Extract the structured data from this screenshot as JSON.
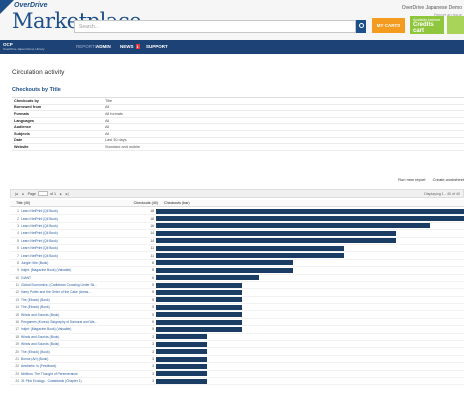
{
  "header": {
    "brand_small": "OverDrive",
    "brand_big": "Marketplace",
    "search_placeholder": "Search...",
    "user_line1": "OverDrive Japanese Demo",
    "user_line2": "Report an issue",
    "orange_button": "MY CARTS",
    "credits_caption": "Available balance",
    "credits_label": "Credits cart"
  },
  "nav": {
    "org_name": "OCP",
    "org_sub": "OverDrive Japan Demo Library",
    "items": [
      {
        "label": "REPORTS",
        "dim": true
      },
      {
        "label": "ADMIN",
        "dim": false
      },
      {
        "label": "NEWS",
        "dim": false,
        "badge": "1"
      },
      {
        "label": "SUPPORT",
        "dim": false
      }
    ]
  },
  "page": {
    "title": "Circulation activity",
    "section_title": "Checkouts by Title"
  },
  "criteria": [
    {
      "key": "Checkouts by",
      "value": "Title"
    },
    {
      "key": "Borrowed from",
      "value": "All"
    },
    {
      "key": "Formats",
      "value": "All formats"
    },
    {
      "key": "Languages",
      "value": "All"
    },
    {
      "key": "Audience",
      "value": "All"
    },
    {
      "key": "Subjects",
      "value": "All"
    },
    {
      "key": "Date",
      "value": "Last 30 days"
    },
    {
      "key": "Website",
      "value": "Standard and mobile"
    }
  ],
  "actions": {
    "save_report": "Run new report",
    "create_worksheet": "Create worksheet"
  },
  "pager": {
    "page_label": "Page",
    "of_label": "of 1",
    "right_text": "Displaying 1 - 40 of 40"
  },
  "table": {
    "col_title": "Title (40)",
    "col_checkouts": "Checkouts (40)",
    "col_chart": "Checkouts (bar)"
  },
  "chart_data": {
    "type": "bar",
    "categories": [
      "Learn NetPrint (Qii Book)",
      "Learn NetPrint (Qii Book)",
      "Learn NetPrint (Qii Book)",
      "Learn NetPrint (Qii Book)",
      "Learn NetPrint (Qii Book)",
      "Learn NetPrint (Qii Book)",
      "Learn NetPrint (Qii Book)",
      "Jungle: title (Book)",
      "Inkjet: (Magazine Book) (Valuable)",
      "GIANT",
      "Global Economics: (Caribbean Crossing Under Sk...",
      "Harry Potter and the Order of the Cake (Amaz...",
      "The (Ebook) (Book)",
      "The (Ebook) (Book)",
      "Winds and Sounds (Book)",
      "Pengames (Korea): Biography of Samurai and Wa...",
      "Inkjet: (Magazine Book) (Valuable)",
      "Winds and Sounds (Book)",
      "Winds and Sounds (Book)",
      "The (Ebook) (Book)",
      "Bonus (Art) (Book)",
      "Aesthetic: is (Feedback)",
      "Nihilism: The Thought of Perseverance",
      "31 Pink Ecology - Coastlands (Chapter 1)"
    ],
    "values": [
      18,
      18,
      16,
      14,
      14,
      11,
      11,
      8,
      8,
      6,
      5,
      5,
      5,
      5,
      5,
      5,
      5,
      3,
      3,
      3,
      3,
      3,
      3,
      3
    ],
    "max": 18
  }
}
